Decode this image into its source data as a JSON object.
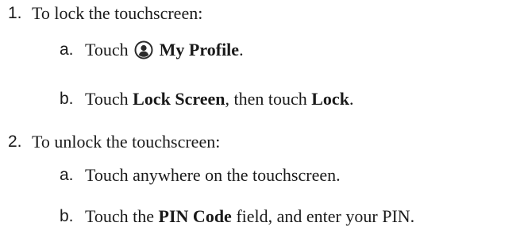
{
  "steps": [
    {
      "number": "1.",
      "text": "To lock the touchscreen:",
      "substeps": [
        {
          "letter": "a.",
          "parts": [
            "Touch",
            "My Profile",
            "."
          ],
          "icon": "profile-icon"
        },
        {
          "letter": "b.",
          "parts": [
            "Touch ",
            "Lock Screen",
            ", then touch ",
            "Lock",
            "."
          ]
        }
      ]
    },
    {
      "number": "2.",
      "text": "To unlock the touchscreen:",
      "substeps": [
        {
          "letter": "a.",
          "parts": [
            "Touch anywhere on the touchscreen."
          ]
        },
        {
          "letter": "b.",
          "parts": [
            "Touch the ",
            "PIN Code",
            " field, and enter your PIN."
          ]
        }
      ]
    }
  ]
}
